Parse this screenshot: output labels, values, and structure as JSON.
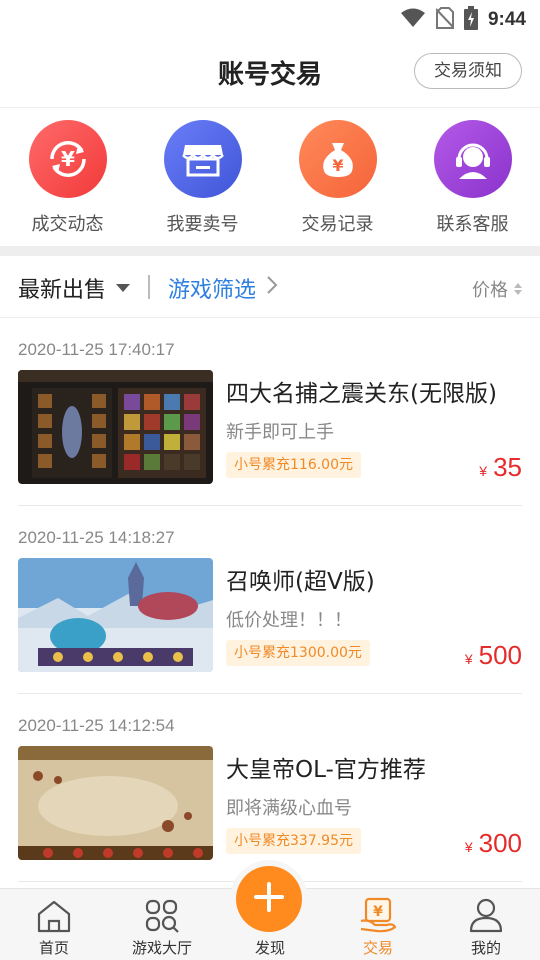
{
  "status_bar": {
    "time": "9:44"
  },
  "header": {
    "title": "账号交易",
    "notice_button": "交易须知"
  },
  "quick_nav": [
    {
      "label": "成交动态",
      "icon": "yen-refresh-icon",
      "color": "#f23a3a"
    },
    {
      "label": "我要卖号",
      "icon": "storefront-icon",
      "color": "#4055d8"
    },
    {
      "label": "交易记录",
      "icon": "money-bag-icon",
      "color": "#f5643a"
    },
    {
      "label": "联系客服",
      "icon": "headset-icon",
      "color": "#8a32cc"
    }
  ],
  "filter_bar": {
    "latest": "最新出售",
    "game_filter": "游戏筛选",
    "price": "价格"
  },
  "listings": [
    {
      "time": "2020-11-25 17:40:17",
      "name": "四大名捕之震关东(无限版)",
      "desc": "新手即可上手",
      "tag": "小号累充116.00元",
      "currency": "¥",
      "price": "35"
    },
    {
      "time": "2020-11-25 14:18:27",
      "name": "召唤师(超V版)",
      "desc": "低价处理！！！",
      "tag": "小号累充1300.00元",
      "currency": "¥",
      "price": "500"
    },
    {
      "time": "2020-11-25 14:12:54",
      "name": "大皇帝OL-官方推荐",
      "desc": "即将满级心血号",
      "tag": "小号累充337.95元",
      "currency": "¥",
      "price": "300"
    }
  ],
  "tab_bar": [
    {
      "label": "首页",
      "icon": "home-icon"
    },
    {
      "label": "游戏大厅",
      "icon": "grid-search-icon"
    },
    {
      "label": "发现",
      "icon": "plus-icon"
    },
    {
      "label": "交易",
      "icon": "trade-yen-icon",
      "active": true
    },
    {
      "label": "我的",
      "icon": "user-icon"
    }
  ],
  "colors": {
    "accent": "#f08a28",
    "price": "#e52b2b",
    "link": "#2f7fe0",
    "fab": "#ff8a1e"
  }
}
